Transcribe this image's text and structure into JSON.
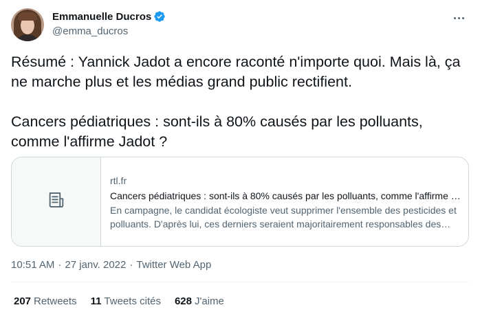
{
  "user": {
    "display_name": "Emmanuelle Ducros",
    "handle": "@emma_ducros",
    "verified": true
  },
  "tweet": {
    "text": "Résumé : Yannick Jadot a encore raconté n'importe quoi. Mais là, ça ne marche plus et les médias grand public rectifient.\n\nCancers pédiatriques : sont-ils à 80% causés par les polluants, comme l'affirme Jadot ?"
  },
  "card": {
    "domain": "rtl.fr",
    "title": "Cancers pédiatriques : sont-ils à 80% causés par les polluants, comme l'affirme Jadot ?",
    "description": "En campagne, le candidat écologiste veut supprimer l'ensemble des pesticides et polluants. D'après lui, ces derniers seraient majoritairement responsables des cancers pédiatriques.",
    "icon": "document-icon"
  },
  "meta": {
    "time": "10:51 AM",
    "separator": "·",
    "date": "27 janv. 2022",
    "app": "Twitter Web App"
  },
  "stats": [
    {
      "value": "207",
      "label": "Retweets"
    },
    {
      "value": "11",
      "label": "Tweets cités"
    },
    {
      "value": "628",
      "label": "J'aime"
    }
  ],
  "colors": {
    "text": "#0f1419",
    "secondary": "#536471",
    "border": "#cfd9de",
    "verified": "#1d9bf0"
  }
}
